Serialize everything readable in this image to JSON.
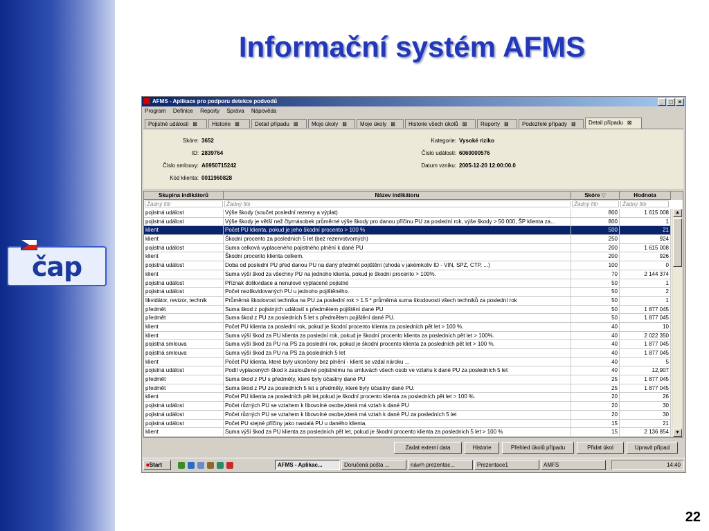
{
  "slide": {
    "title": "Informační systém AFMS",
    "page_number": "22",
    "logo_text": "čap"
  },
  "window": {
    "title": "AFMS - Aplikace pro podporu detekce podvodů",
    "menu": [
      "Program",
      "Definice",
      "Reporty",
      "Správa",
      "Nápověda"
    ],
    "tabs": [
      "Pojistné události",
      "Historie",
      "Detail případu",
      "Moje úkoly",
      "Moje úkoly",
      "Historie všech úkolů",
      "Reporty",
      "Podezřelé případy",
      "Detail případu"
    ],
    "tab_close_glyph": "⊠",
    "details": {
      "skore_label": "Skóre:",
      "skore": "3652",
      "id_label": "ID:",
      "id": "2839764",
      "smlouva_label": "Číslo smlouvy:",
      "smlouva": "A6950715242",
      "klient_label": "Kód klienta:",
      "klient": "0011960828",
      "kategorie_label": "Kategorie:",
      "kategorie": "Vysoké riziko",
      "udalost_label": "Číslo události:",
      "udalost": "6060000576",
      "vznik_label": "Datum vzniku:",
      "vznik": "2005-12-20 12:00:00.0"
    },
    "grid": {
      "headers": [
        "Skupina indikátorů",
        "Název indikátoru",
        "Skóre",
        "Hodnota"
      ],
      "filter_placeholder": "Žádný filtr",
      "rows": [
        [
          "pojistná událost",
          "Výše škody (součet poslední rezervy a výplat)",
          "800",
          "1 615 008"
        ],
        [
          "pojistná událost",
          "Výše škody je větší než čtyrnásobek průměrné výše škody pro danou příčinu PU za poslední rok, výše škody > 50 000, ŠP klienta za...",
          "800",
          "1"
        ],
        [
          "klient",
          "Počet PU klienta, pokud je jeho škodní procento > 100 %",
          "500",
          "21"
        ],
        [
          "klient",
          "Škodní procento za posledních 5 let (bez rezervotvorných)",
          "250",
          "924"
        ],
        [
          "pojistná událost",
          "Suma celková vyplaceného pojistného plnění k dané PU",
          "200",
          "1 615 008"
        ],
        [
          "klient",
          "Škodní procento klienta celkem.",
          "200",
          "926"
        ],
        [
          "pojistná událost",
          "Doba od poslední PU před danou PU na daný předmět pojištění (shoda v jakémkoliv ID - VIN, SPZ, CTP, ...)",
          "100",
          "0"
        ],
        [
          "klient",
          "Suma výší škod za všechny PU na jednoho klienta, pokud je škodní procento > 100%.",
          "70",
          "2 144 374"
        ],
        [
          "pojistná událost",
          "Příznak dolikvidace a nenulové vyplacené pojistné",
          "50",
          "1"
        ],
        [
          "pojistná událost",
          "Počet nezlikvidovaných PU u jednoho pojištěného.",
          "50",
          "2"
        ],
        [
          "likvidátor, revizor, technik",
          "Průměrná škodovost technika na PU za poslední rok > 1.5 * průměrná suma škodovosti všech techniků za poslední rok",
          "50",
          "1"
        ],
        [
          "předmět",
          "Suma škod z pojistných událostí s předmětem pojištění dané PU",
          "50",
          "1 877 045"
        ],
        [
          "předmět",
          "Suma škod z PU za posledních 5 let s předmětem pojištění dané PU.",
          "50",
          "1 877 045"
        ],
        [
          "klient",
          "Počet PU klienta za poslední rok, pokud je škodní procento klienta za posledních pět let > 100 %.",
          "40",
          "10"
        ],
        [
          "klient",
          "Suma výší škod za PU klienta za poslední rok, pokud je škodní procento klienta za posledních pět let > 100%.",
          "40",
          "2 022 350"
        ],
        [
          "pojistná smlouva",
          "Suma výší škod za PU na PS za poslední rok, pokud je škodní procento klienta za posledních pět let > 100 %.",
          "40",
          "1 877 045"
        ],
        [
          "pojistná smlouva",
          "Suma výší škod za PU na PS za posledních 5 let",
          "40",
          "1 877 045"
        ],
        [
          "klient",
          "Počet PU klienta, které byly ukončeny bez plnění - klient se vzdal nároku ...",
          "40",
          "5"
        ],
        [
          "pojistná událost",
          "Podíl vyplacených škod k zasloužené pojistnému na smluvách všech osob ve vztahu k dané PU za posledních 5 let",
          "40",
          "12,907"
        ],
        [
          "předmět",
          "Suma škod z PU s předměty, které byly účastny dané PU",
          "25",
          "1 877 045"
        ],
        [
          "předmět",
          "Suma škod z PU za posledních 5 let s předměty, které byly účastny dané PU.",
          "25",
          "1 877 045"
        ],
        [
          "klient",
          "Počet PU klienta za posledních pět let,pokud je škodní procento klienta za posledních pět let > 100 %.",
          "20",
          "26"
        ],
        [
          "pojistná událost",
          "Počet různých PU se vztahem k libovolné osobe,která má vztah k dané PU",
          "20",
          "30"
        ],
        [
          "pojistná událost",
          "Počet různých PU se vztahem k libovolné osobe,která má vztah k dané PU za posledních 5 let",
          "20",
          "30"
        ],
        [
          "pojistná událost",
          "Počet PU stejné příčiny jako nastalá PU u daného klienta.",
          "15",
          "21"
        ],
        [
          "klient",
          "Suma výší škod za PU klienta za posledních pět let, pokud je škodní procento klienta za posledních 5 let > 100 %",
          "15",
          "2 136 854"
        ]
      ],
      "selected_row": 2
    },
    "buttons": [
      "Zadat externí data",
      "Historie",
      "Přehled úkolů případu",
      "Přidat úkol",
      "Upravit případ"
    ]
  },
  "taskbar": {
    "start": "Start",
    "items": [
      "AFMS - Aplikac...",
      "Doručená pošta ...",
      "návrh prezentac...",
      "Prezentace1",
      "AMFS"
    ],
    "clock": "14:40"
  }
}
